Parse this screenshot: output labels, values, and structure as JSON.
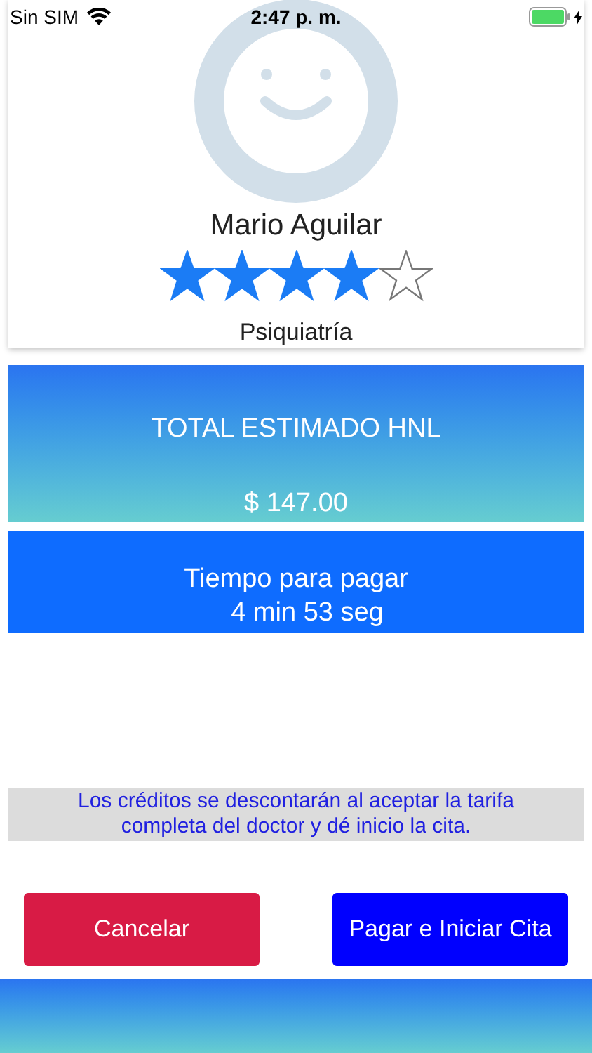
{
  "status_bar": {
    "carrier": "Sin SIM",
    "time": "2:47 p. m."
  },
  "doctor": {
    "name": "Mario Aguilar",
    "stars": 4,
    "specialty": "Psiquiatría"
  },
  "total": {
    "label": "TOTAL ESTIMADO HNL",
    "amount": "$ 147.00"
  },
  "timer": {
    "label": "Tiempo para pagar",
    "remaining": "4 min 53 seg"
  },
  "notice": "Los créditos se descontarán al aceptar la tarifa completa del doctor y dé inicio la cita.",
  "buttons": [
    {
      "label": "Cancelar",
      "kind": "cancel"
    },
    {
      "label": "Pagar e Iniciar Cita",
      "kind": "confirm"
    }
  ]
}
